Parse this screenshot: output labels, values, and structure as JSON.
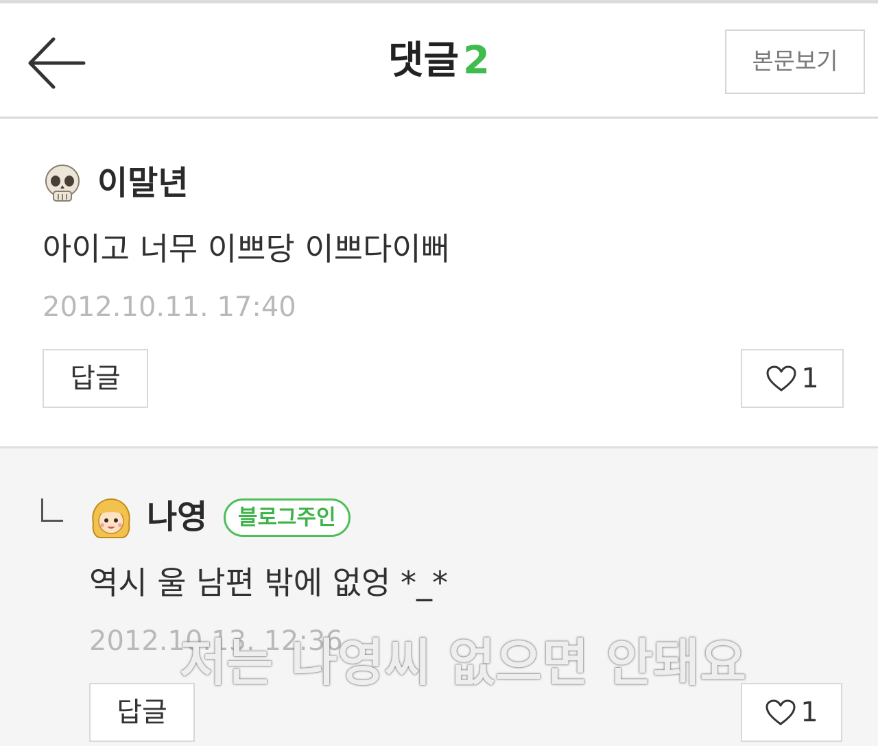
{
  "header": {
    "title": "댓글",
    "comment_count": "2",
    "view_post_label": "본문보기",
    "accent_color": "#3fbc4b"
  },
  "comments": [
    {
      "avatar_icon": "skull-emoji-icon",
      "author": "이말년",
      "text": "아이고 너무 이쁘당 이쁘다이뻐",
      "date": "2012.10.11. 17:40",
      "reply_label": "답글",
      "like_count": "1"
    },
    {
      "avatar_icon": "blonde-girl-emoji-icon",
      "author": "나영",
      "badge": "블로그주인",
      "text": "역시 울 남편 밖에 없엉 *_*",
      "date": "2012.10.13. 12:36",
      "reply_label": "답글",
      "like_count": "1"
    }
  ],
  "overlay_caption": "저는 나영씨 없으면 안돼요"
}
